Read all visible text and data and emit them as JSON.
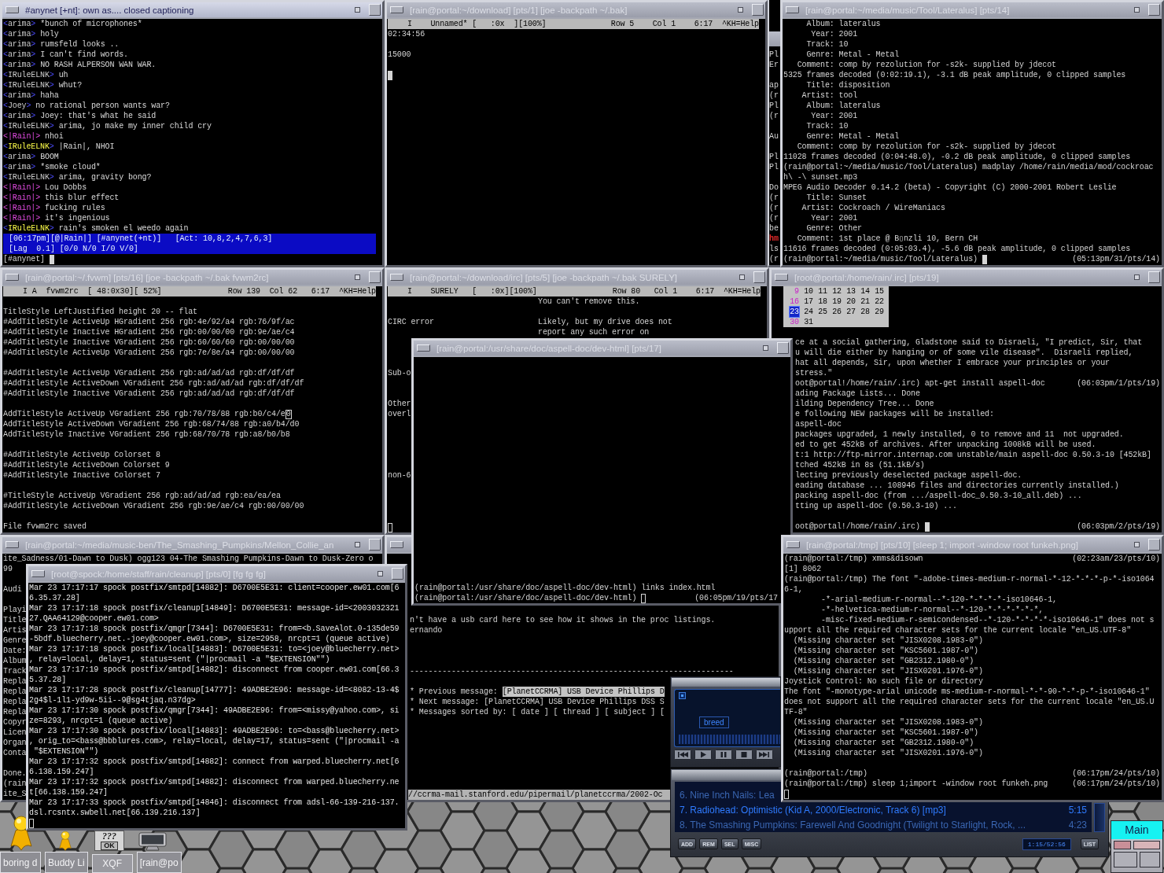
{
  "irc_window": {
    "title": "#anynet [+nt]: own as.... closed captioning",
    "active": true,
    "messages": [
      {
        "kind": "normal",
        "open": "<",
        "nick": "arima",
        "close": ">",
        "text": "*bunch of microphones*"
      },
      {
        "kind": "normal",
        "open": "<",
        "nick": "arima",
        "close": ">",
        "text": "holy"
      },
      {
        "kind": "normal",
        "open": "<",
        "nick": "arima",
        "close": ">",
        "text": "rumsfeld looks .."
      },
      {
        "kind": "normal",
        "open": "<",
        "nick": "arima",
        "close": ">",
        "text": "I can't find words."
      },
      {
        "kind": "normal",
        "open": "<",
        "nick": "arima",
        "close": ">",
        "text": "NO RASH ALPERSON WAN WAR."
      },
      {
        "kind": "normal",
        "open": "<",
        "nick": "IRuleELNK",
        "close": ">",
        "text": "uh"
      },
      {
        "kind": "normal",
        "open": "<",
        "nick": "IRuleELNK",
        "close": ">",
        "text": "whut?"
      },
      {
        "kind": "normal",
        "open": "<",
        "nick": "arima",
        "close": ">",
        "text": "haha"
      },
      {
        "kind": "normal",
        "open": "<",
        "nick": "Joey",
        "close": ">",
        "text": "no rational person wants war?"
      },
      {
        "kind": "normal",
        "open": "<",
        "nick": "arima",
        "close": ">",
        "text": "Joey: that's what he said"
      },
      {
        "kind": "normal",
        "open": "<",
        "nick": "IRuleELNK",
        "close": ">",
        "text": "arima, jo make my inner child cry"
      },
      {
        "kind": "own",
        "open": "<",
        "nick": "|Rain|",
        "close": ">",
        "text": "nhoi"
      },
      {
        "kind": "highlight",
        "open": "<",
        "nick": "IRuleELNK",
        "close": ">",
        "text": "|Rain|, NHOI"
      },
      {
        "kind": "normal",
        "open": "<",
        "nick": "arima",
        "close": ">",
        "text": "BOOM"
      },
      {
        "kind": "normal",
        "open": "<",
        "nick": "arima",
        "close": ">",
        "text": "*smoke cloud*"
      },
      {
        "kind": "normal",
        "open": "<",
        "nick": "IRuleELNK",
        "close": ">",
        "text": "arima, gravity bong?"
      },
      {
        "kind": "own",
        "open": "<",
        "nick": "|Rain|",
        "close": ">",
        "text": "Lou Dobbs"
      },
      {
        "kind": "own",
        "open": "<",
        "nick": "|Rain|",
        "close": ">",
        "text": "this blur effect"
      },
      {
        "kind": "own",
        "open": "<",
        "nick": "|Rain|",
        "close": ">",
        "text": "fucking rules"
      },
      {
        "kind": "own",
        "open": "<",
        "nick": "|Rain|",
        "close": ">",
        "text": "it's ingenious"
      },
      {
        "kind": "highlight",
        "open": "<",
        "nick": "IRuleELNK",
        "close": ">",
        "text": "rain's smoken el weedo again"
      }
    ],
    "status_lines": [
      "[06:17pm][@|Rain|] [#anynet(+nt)]   [Act: 10,8,2,4,7,6,3]",
      "[Lag  0.1] [0/0 N/0 I/0 V/0]"
    ],
    "prompt": "[#anynet]",
    "cursor": {
      "kind": "block"
    }
  },
  "download_editor": {
    "title": "[rain@portal:~/download] [pts/1] [joe -backpath ~/.bak]",
    "active": false,
    "status_left": "I    Unnamed* [   :0x  ][100%]",
    "status_right": "Row 5    Col 1    6:17  ^KH=Help",
    "blocks": [
      [
        "02:34:56"
      ],
      [
        "15000"
      ],
      [
        {
          "cursor": {
            "kind": "block"
          }
        }
      ]
    ]
  },
  "covered_terminal": {
    "active": false,
    "blocks": [
      [
        "Pl",
        "Er"
      ],
      [
        "ap",
        "(r",
        "Pl",
        "(r"
      ],
      [
        "Au"
      ],
      [
        "Pl",
        "Pl"
      ],
      [
        "Do",
        "(r",
        "(r",
        "(r",
        "be",
        {
          "text": "hm",
          "color": "#e02a2a"
        },
        "ls",
        "(r"
      ]
    ]
  },
  "music_terminal": {
    "title": "[rain@portal:~/media/music/Tool/Lateralus] [pts/14]",
    "active": false,
    "blocks": [
      [
        "     Album: lateralus",
        "      Year: 2001",
        "     Track: 10",
        "     Genre: Metal - Metal",
        "   Comment: comp by rezolution for -s2k- supplied by jdecot",
        "5325 frames decoded (0:02:19.1), -3.1 dB peak amplitude, 0 clipped samples",
        "     Title: disposition",
        "    Artist: tool",
        "     Album: lateralus",
        "      Year: 2001",
        "     Track: 10",
        "     Genre: Metal - Metal",
        "   Comment: comp by rezolution for -s2k- supplied by jdecot",
        "11028 frames decoded (0:04:48.0), -0.2 dB peak amplitude, 0 clipped samples",
        "(rain@portal:~/media/music/Tool/Lateralus) madplay /home/rain/media/mod/cockroac",
        "h\\ -\\ sunset.mp3",
        "MPEG Audio Decoder 0.14.2 (beta) - Copyright (C) 2000-2001 Robert Leslie",
        "     Title: Sunset",
        "    Artist: Cockroach / WireManiacs",
        "      Year: 2001",
        "     Genre: Other",
        "   Comment: 1st place @ B▯nzli 10, Bern CH",
        "11616 frames decoded (0:05:03.4), -5.6 dB peak amplitude, 0 clipped samples",
        {
          "text": "(rain@portal:~/media/music/Tool/Lateralus)",
          "cursor": {
            "kind": "block"
          },
          "stamp": "(05:13pm/31/pts/14)"
        }
      ]
    ]
  },
  "fvwm_editor": {
    "title": "[rain@portal:~/.fvwm] [pts/16] [joe -backpath ~/.bak fvwm2rc]",
    "active": false,
    "status_left": "I A  fvwm2rc  [ 48:0x30][ 52%]",
    "status_right": "Row 139  Col 62   6:17  ^KH=Help",
    "blocks": [
      [
        "TitleStyle LeftJustified height 20 -- flat",
        "#AddTitleStyle ActiveUp HGradient 256 rgb:4e/92/a4 rgb:76/9f/ac",
        "#AddTitleStyle Inactive HGradient 256 rgb:00/00/00 rgb:9e/ae/c4",
        "#AddTitleStyle Inactive VGradient 256 rgb:60/60/60 rgb:00/00/00",
        "#AddTitleStyle ActiveUp VGradient 256 rgb:7e/8e/a4 rgb:00/00/00"
      ],
      [
        "#AddTitleStyle ActiveUp VGradient 256 rgb:ad/ad/ad rgb:df/df/df",
        "#AddTitleStyle ActiveDown VGradient 256 rgb:ad/ad/ad rgb:df/df/df",
        "#AddTitleStyle Inactive VGradient 256 rgb:ad/ad/ad rgb:df/df/df"
      ],
      [
        {
          "text": "AddTitleStyle ActiveUp VGradient 256 rgb:70/78/88 rgb:b0/c4/e",
          "cursor": {
            "kind": "hollow",
            "text": "0"
          }
        },
        "AddTitleStyle ActiveDown VGradient 256 rgb:68/74/88 rgb:a0/b4/d0",
        "AddTitleStyle Inactive VGradient 256 rgb:68/70/78 rgb:a8/b0/b8"
      ],
      [
        "#AddTitleStyle ActiveUp Colorset 8",
        "#AddTitleStyle ActiveDown Colorset 9",
        "#AddTitleStyle Inactive Colorset 7"
      ],
      [
        "#TitleStyle ActiveUp VGradient 256 rgb:ad/ad/ad rgb:ea/ea/ea",
        "#AddTitleStyle ActiveDown VGradient 256 rgb:9e/ae/c4 rgb:00/00/00"
      ],
      [
        "File fvwm2rc saved"
      ]
    ]
  },
  "surely_editor": {
    "title": "[rain@portal:~/download/irc] [pts/5] [joe -backpath ~/.bak SURELY]",
    "active": false,
    "status_left": "I    SURELY   [   :0x][100%]",
    "status_right": "Row 80   Col 1    6:17  ^KH=Help",
    "left_notes": [
      [
        "CIRC error"
      ],
      [
        "Sub-o"
      ],
      [
        "Other",
        "overl"
      ],
      [
        "non-6"
      ]
    ],
    "right_notes": [
      [
        "You can't remove this."
      ],
      [
        "Likely, but my drive does not",
        "report any such error on"
      ]
    ],
    "cursor": {
      "kind": "hollow"
    }
  },
  "root_terminal": {
    "title": "[root@portal:/home/rain/.irc] [pts/19]",
    "active": false,
    "calendar": [
      [
        {
          "day": "9",
          "selected": false
        },
        {
          "day": "10",
          "selected": false
        },
        {
          "day": "11",
          "selected": false
        },
        {
          "day": "12",
          "selected": false
        },
        {
          "day": "13",
          "selected": false
        },
        {
          "day": "14",
          "selected": false
        },
        {
          "day": "15",
          "selected": false
        }
      ],
      [
        {
          "day": "16",
          "selected": false
        },
        {
          "day": "17",
          "selected": false
        },
        {
          "day": "18",
          "selected": false
        },
        {
          "day": "19",
          "selected": false
        },
        {
          "day": "20",
          "selected": false
        },
        {
          "day": "21",
          "selected": false
        },
        {
          "day": "22",
          "selected": false
        }
      ],
      [
        {
          "day": "23",
          "selected": true
        },
        {
          "day": "24",
          "selected": false
        },
        {
          "day": "25",
          "selected": false
        },
        {
          "day": "26",
          "selected": false
        },
        {
          "day": "27",
          "selected": false
        },
        {
          "day": "28",
          "selected": false
        },
        {
          "day": "29",
          "selected": false
        }
      ],
      [
        {
          "day": "30",
          "selected": false
        },
        {
          "day": "31",
          "selected": false
        }
      ]
    ],
    "blocks": [
      [
        "ce at a social gathering, Gladstone said to Disraeli, \"I predict, Sir, that",
        "u will die either by hanging or of some vile disease\".  Disraeli replied,",
        "hat all depends, Sir, upon whether I embrace your principles or your",
        "stress.\"",
        {
          "text": "oot@portal!/home/rain/.irc) apt-get install aspell-doc",
          "stamp": "(06:03pm/1/pts/19)"
        },
        "ading Package Lists... Done",
        "ilding Dependency Tree... Done",
        "e following NEW packages will be installed:",
        "aspell-doc",
        "packages upgraded, 1 newly installed, 0 to remove and 11  not upgraded.",
        "ed to get 452kB of archives. After unpacking 1008kB will be used.",
        "t:1 http://ftp-mirror.internap.com unstable/main aspell-doc 0.50.3-10 [452kB]",
        "tched 452kB in 8s (51.1kB/s)",
        "lecting previously deselected package aspell-doc.",
        "eading database ... 108946 files and directories currently installed.)",
        "packing aspell-doc (from .../aspell-doc_0.50.3-10_all.deb) ...",
        "tting up aspell-doc (0.50.3-10) ..."
      ],
      [
        {
          "text": "oot@portal!/home/rain/.irc)",
          "cursor": {
            "kind": "block"
          },
          "stamp": "(06:03pm/2/pts/19)"
        }
      ]
    ]
  },
  "aspell_terminal": {
    "title": "[rain@portal:/usr/share/doc/aspell-doc/dev-html] [pts/17]",
    "active": false,
    "blocks": [
      [
        "(rain@portal:/usr/share/doc/aspell-doc/dev-html) links index.html",
        {
          "text": "(rain@portal:/usr/share/doc/aspell-doc/dev-html)",
          "cursor": {
            "kind": "hollow"
          },
          "stamp": "(06:05pm/19/pts/17"
        }
      ]
    ]
  },
  "ben_terminal": {
    "title": "[rain@portal:~/media/music-ben/The_Smashing_Pumpkins/Mellon_Collie_an",
    "active": false,
    "blocks": [
      [
        "ite_Sadness/01-Dawn to Dusk) ogg123 04-The Smashing Pumpkins-Dawn to Dusk-Zero o",
        "99"
      ],
      [
        "Audi"
      ],
      [
        "Playi",
        "Title",
        "Artis",
        "Genre",
        "Date:",
        "Album",
        "Track",
        "Repla",
        "Repla",
        "Repla",
        "Repla",
        "Copyr",
        "Licen",
        "Organ",
        "Conta"
      ],
      [
        "Done.",
        "(rain",
        "ite_S"
      ]
    ]
  },
  "log_terminal": {
    "title": "[root@spock:/home/staff/rain/cleanup] [pts/0] [fg fg fg]",
    "active": false,
    "blocks": [
      [
        "Mar 23 17:17:17 spock postfix/smtpd[14882]: D6700E5E31: client=cooper.ew01.com[6",
        "6.35.37.28]",
        "Mar 23 17:17:18 spock postfix/cleanup[14849]: D6700E5E31: message-id=<2003032321",
        "27.QAA64129@cooper.ew01.com>",
        "Mar 23 17:17:18 spock postfix/qmgr[7344]: D6700E5E31: from=<b.SaveAlot.0-135de59",
        "-5bdf.bluecherry.net.-joey@cooper.ew01.com>, size=2958, nrcpt=1 (queue active)",
        "Mar 23 17:17:18 spock postfix/local[14883]: D6700E5E31: to=<joey@bluecherry.net>",
        ", relay=local, delay=1, status=sent (\"|procmail -a \"$EXTENSION\"\")",
        "Mar 23 17:17:19 spock postfix/smtpd[14882]: disconnect from cooper.ew01.com[66.3",
        "5.37.28]",
        "Mar 23 17:17:28 spock postfix/cleanup[14777]: 49ADBE2E96: message-id=<8082-13-4$",
        "2g4$l-1l1-yd9w-5ii--9@sg4tjaq.n37dg>",
        "Mar 23 17:17:30 spock postfix/qmgr[7344]: 49ADBE2E96: from=<missy@yahoo.com>, si",
        "ze=8293, nrcpt=1 (queue active)",
        "Mar 23 17:17:30 spock postfix/local[14883]: 49ADBE2E96: to=<bass@bluecherry.net>",
        ", orig_to=<bass@bbblures.com>, relay=local, delay=17, status=sent (\"|procmail -a",
        " \"$EXTENSION\"\")",
        "Mar 23 17:17:32 spock postfix/smtpd[14882]: connect from warped.bluecherry.net[6",
        "6.138.159.247]",
        "Mar 23 17:17:32 spock postfix/smtpd[14882]: disconnect from warped.bluecherry.ne",
        "t[66.138.159.247]",
        "Mar 23 17:17:33 spock postfix/smtpd[14846]: disconnect from adsl-66-139-216-137.",
        "dsl.rcsntx.swbell.net[66.139.216.137]",
        {
          "cursor": {
            "kind": "hollow"
          }
        }
      ]
    ]
  },
  "links_browser": {
    "active": false,
    "message_lines": [
      "n't have a usb card here to see how it shows in the proc listings.",
      "ernando"
    ],
    "rule": "----------------------------------------------------------------------",
    "nav": [
      {
        "label": "* Previous message:",
        "links": [
          {
            "text": "[PlanetCCRMA] USB Device Phillips D",
            "selected": true
          }
        ]
      },
      {
        "label": "* Next message:",
        "links": [
          {
            "text": "[PlanetCCRMA] USB Device Phillips DSS S",
            "selected": false
          }
        ]
      },
      {
        "label": "* Messages sorted by:",
        "links": [
          {
            "text": "[ date ]",
            "selected": false
          },
          {
            "text": "[ thread ]",
            "selected": false
          },
          {
            "text": "[ subject ]",
            "selected": false
          },
          {
            "text": "[",
            "selected": false
          }
        ]
      }
    ],
    "status": "//ccrma-mail.stanford.edu/pipermail/planetccrma/2002-Oc"
  },
  "media_player": {
    "display_text": "breed",
    "tracks": [
      {
        "title": "6. Nine Inch Nails: Lea",
        "selected": false
      },
      {
        "title": "7. Radiohead: Optimistic (Kid A, 2000/Electronic, Track 6) [mp3]",
        "time": "5:15",
        "selected": true
      },
      {
        "title": "8. The Smashing Pumpkins: Farewell And Goodnight (Twilight to Starlight, Rock, ...",
        "time": "4:23",
        "selected": false
      }
    ],
    "buttons": [
      "ADD",
      "REM",
      "SEL",
      "MISC"
    ],
    "time": "1:15/52:56",
    "list_button": "LIST"
  },
  "tmp_terminal": {
    "title": "[rain@portal:/tmp] [pts/10] [sleep 1; import -window root funkeh.png]",
    "active": false,
    "blocks": [
      [
        {
          "text": "(rain@portal:/tmp) xmms&disown",
          "stamp": "(02:23am/23/pts/10)"
        },
        "[1] 8062",
        "(rain@portal:/tmp) The font \"-adobe-times-medium-r-normal-*-12-*-*-*-p-*-iso1064",
        "6-1,",
        "        -*-arial-medium-r-normal--*-120-*-*-*-*-iso10646-1,",
        "        -*-helvetica-medium-r-normal--*-120-*-*-*-*-*-*,",
        "        -misc-fixed-medium-r-semicondensed--*-120-*-*-*-*-iso10646-1\" does not s",
        "upport all the required character sets for the current locale \"en_US.UTF-8\"",
        "  (Missing character set \"JISX0208.1983-0\")",
        "  (Missing character set \"KSC5601.1987-0\")",
        "  (Missing character set \"GB2312.1980-0\")",
        "  (Missing character set \"JISX0201.1976-0\")",
        "Joystick Control: No such file or directory",
        "The font \"-monotype-arial unicode ms-medium-r-normal-*-*-90-*-*-p-*-iso10646-1\"",
        "does not support all the required character sets for the current locale \"en_US.U",
        "TF-8\"",
        "  (Missing character set \"JISX0208.1983-0\")",
        "  (Missing character set \"KSC5601.1987-0\")",
        "  (Missing character set \"GB2312.1980-0\")",
        "  (Missing character set \"JISX0201.1976-0\")"
      ],
      [
        {
          "text": "(rain@portal:/tmp)",
          "stamp": "(06:17pm/24/pts/10)"
        },
        {
          "text": "(rain@portal:/tmp) sleep 1;import -window root funkeh.png",
          "stamp": "(06:17pm/24/pts/10)"
        },
        {
          "cursor": {
            "kind": "hollow"
          }
        }
      ]
    ]
  },
  "desktop_icons": [
    {
      "kind": "person"
    },
    {
      "kind": "person"
    },
    {
      "kind": "dialog",
      "text": "???",
      "button": "OK"
    },
    {
      "kind": "monitor"
    }
  ],
  "taskbar": [
    {
      "label": "boring d",
      "selected": false
    },
    {
      "label": "Buddy Li",
      "selected": false
    },
    {
      "label": "XQF",
      "selected": true
    },
    {
      "label": "[rain@po",
      "selected": false
    }
  ],
  "pager": {
    "desk_label": "Main"
  }
}
